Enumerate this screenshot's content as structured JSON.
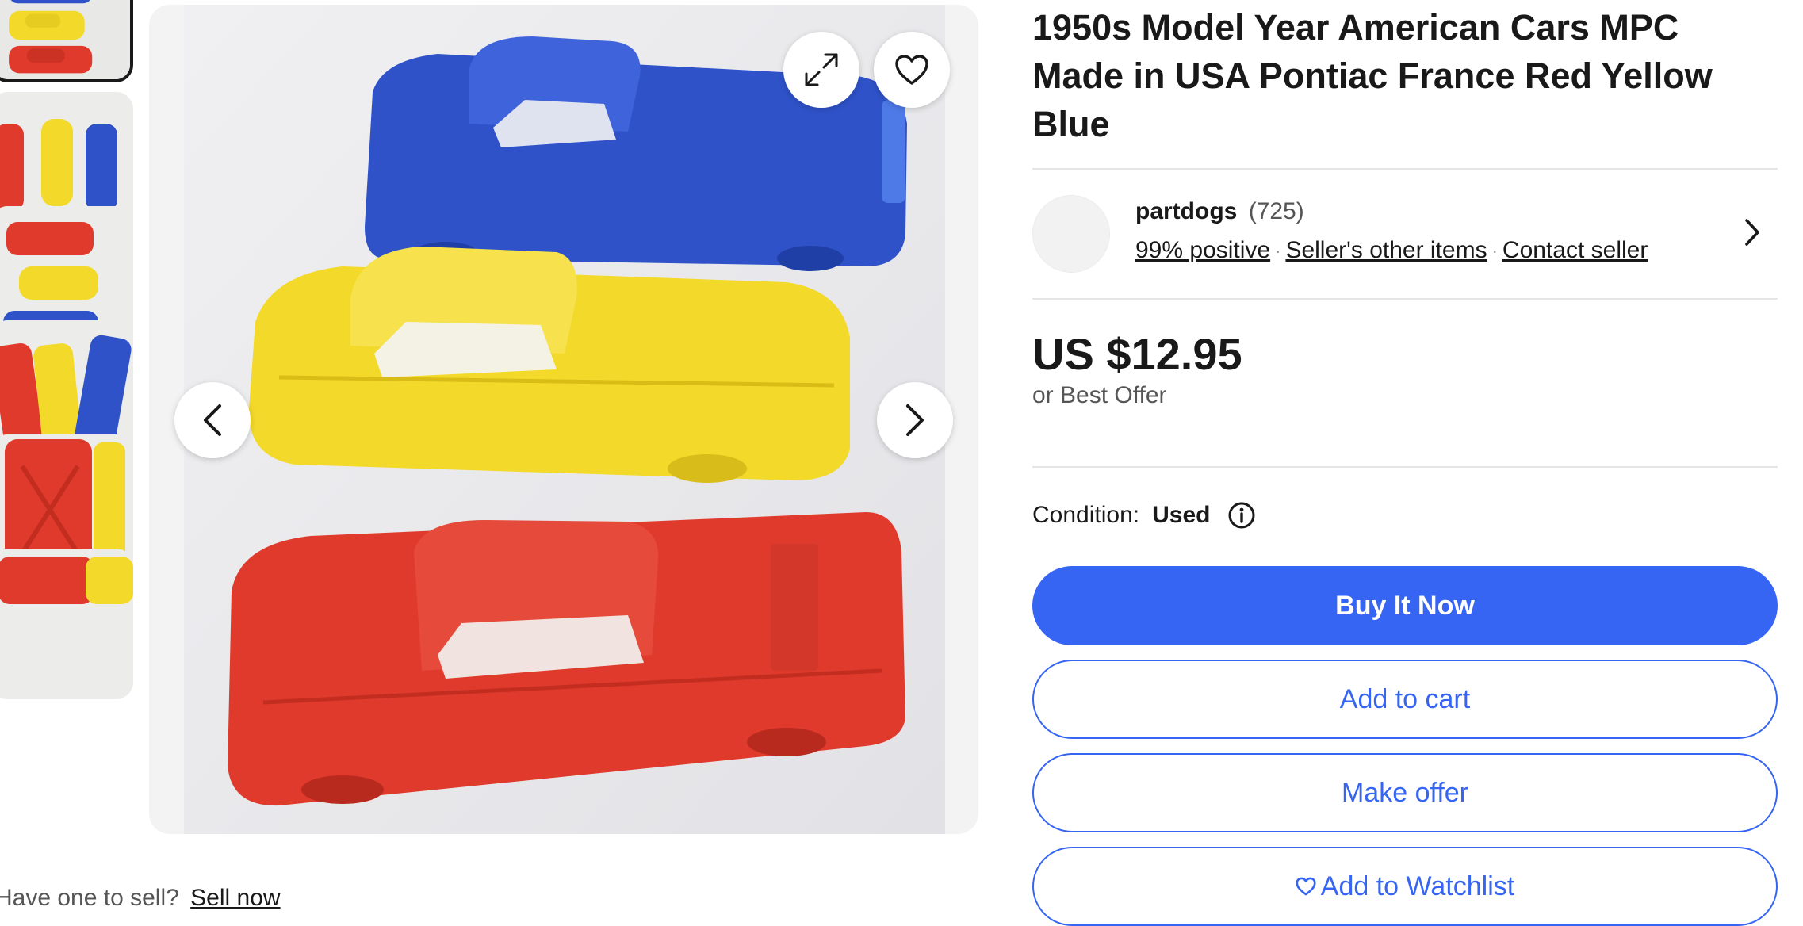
{
  "listing": {
    "title": "1950s Model Year American Cars MPC Made in USA Pontiac France Red Yellow Blue"
  },
  "gallery": {
    "thumbnail_count": 6,
    "selected_index": 0,
    "icons": {
      "expand": "expand-icon",
      "watch": "heart-icon",
      "prev": "chevron-left-icon",
      "next": "chevron-right-icon"
    },
    "car_colors": {
      "blue": "#2f52c9",
      "yellow": "#f3d92a",
      "red": "#e03a2c"
    }
  },
  "sell": {
    "prompt": "Have one to sell?",
    "link": "Sell now"
  },
  "seller": {
    "name": "partdogs",
    "feedback_count": "(725)",
    "positive": "99% positive",
    "other_items": "Seller's other items",
    "contact": "Contact seller"
  },
  "pricing": {
    "price": "US $12.95",
    "offer_note": "or Best Offer"
  },
  "condition": {
    "label": "Condition:",
    "value": "Used"
  },
  "actions": {
    "buy_now": "Buy It Now",
    "add_to_cart": "Add to cart",
    "make_offer": "Make offer",
    "add_to_watchlist": "Add to Watchlist"
  },
  "colors": {
    "accent": "#3665f3",
    "text": "#191919",
    "muted": "#555555"
  }
}
